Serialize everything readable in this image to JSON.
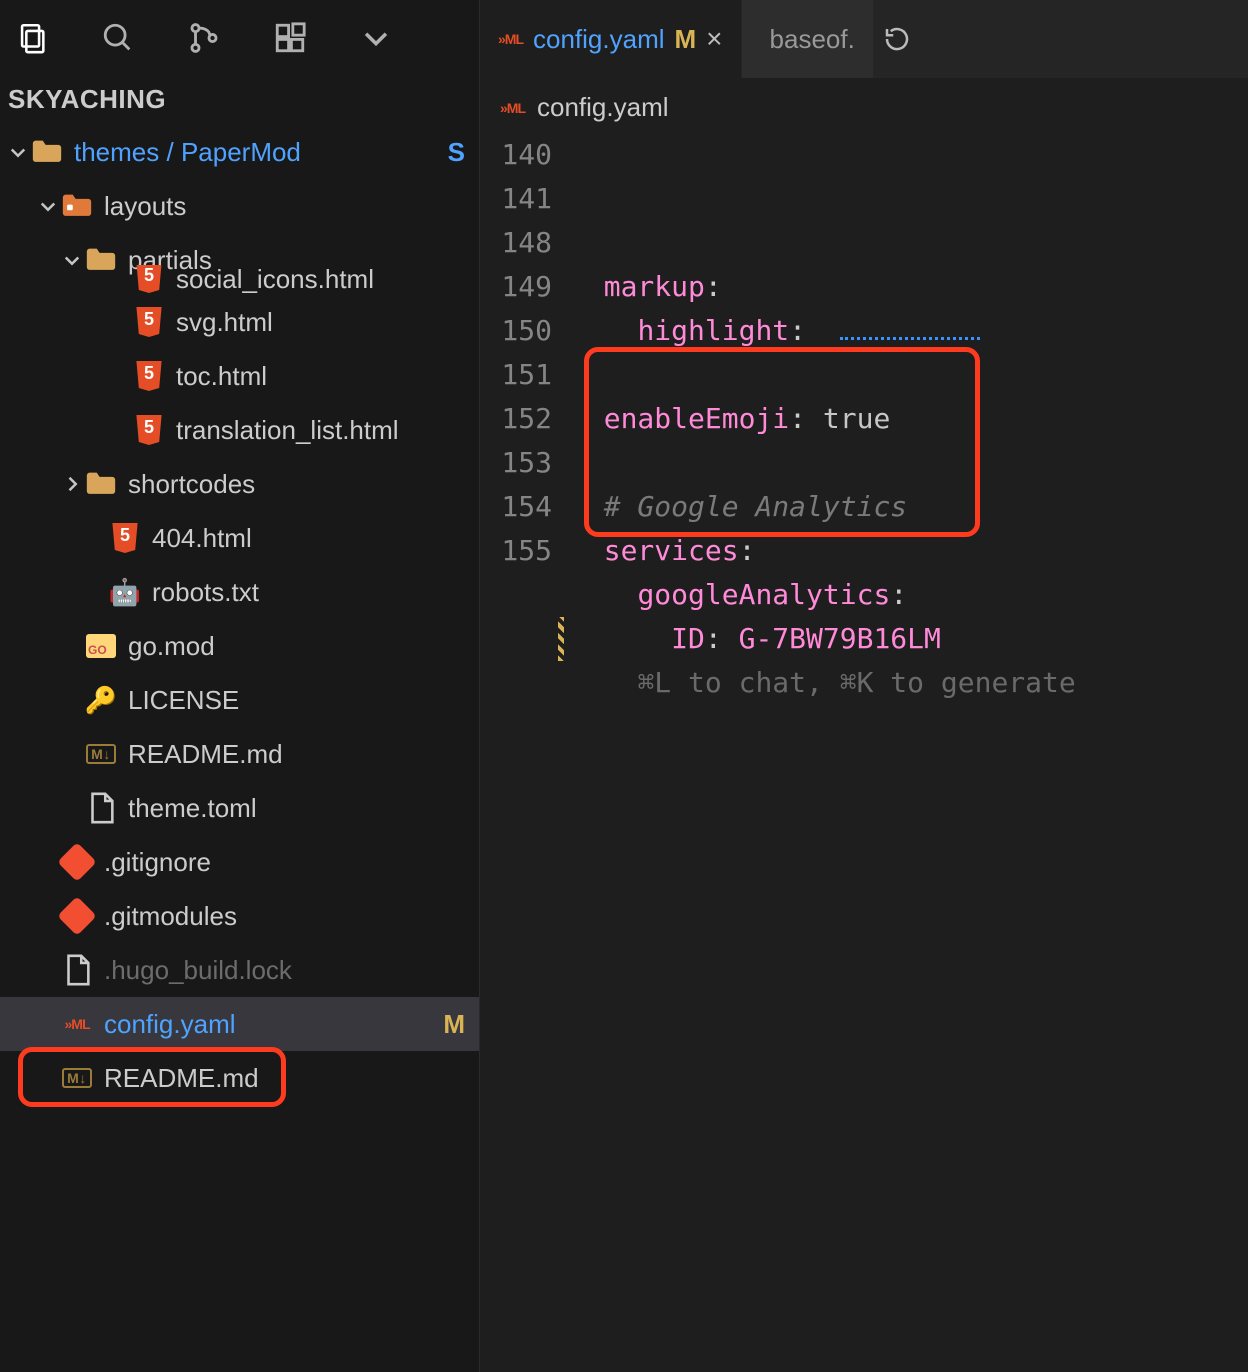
{
  "explorer": {
    "title": "SKYACHING",
    "root": {
      "label_a": "themes",
      "sep": " / ",
      "label_b": "PaperMod",
      "badge": "S"
    },
    "rows": [
      {
        "indent": 36,
        "chev": "v",
        "icon": "folder-orange",
        "label": "layouts"
      },
      {
        "indent": 60,
        "chev": "v",
        "icon": "folder",
        "label": "partials"
      },
      {
        "indent": 108,
        "chev": "",
        "icon": "html5",
        "label": "social_icons.html",
        "cut": true
      },
      {
        "indent": 108,
        "chev": "",
        "icon": "html5",
        "label": "svg.html"
      },
      {
        "indent": 108,
        "chev": "",
        "icon": "html5",
        "label": "toc.html"
      },
      {
        "indent": 108,
        "chev": "",
        "icon": "html5",
        "label": "translation_list.html"
      },
      {
        "indent": 60,
        "chev": ">",
        "icon": "folder",
        "label": "shortcodes"
      },
      {
        "indent": 84,
        "chev": "",
        "icon": "html5",
        "label": "404.html"
      },
      {
        "indent": 84,
        "chev": "",
        "icon": "robot",
        "label": "robots.txt"
      },
      {
        "indent": 60,
        "chev": "",
        "icon": "go",
        "label": "go.mod"
      },
      {
        "indent": 60,
        "chev": "",
        "icon": "key",
        "label": "LICENSE"
      },
      {
        "indent": 60,
        "chev": "",
        "icon": "md",
        "label": "README.md"
      },
      {
        "indent": 60,
        "chev": "",
        "icon": "file",
        "label": "theme.toml"
      },
      {
        "indent": 36,
        "chev": "",
        "icon": "git",
        "label": ".gitignore"
      },
      {
        "indent": 36,
        "chev": "",
        "icon": "git",
        "label": ".gitmodules"
      },
      {
        "indent": 36,
        "chev": "",
        "icon": "file",
        "label": ".hugo_build.lock",
        "dim": true
      },
      {
        "indent": 36,
        "chev": "",
        "icon": "yaml",
        "label": "config.yaml",
        "blue": true,
        "badge": "M",
        "selected": true
      },
      {
        "indent": 36,
        "chev": "",
        "icon": "md",
        "label": "README.md"
      }
    ]
  },
  "tabs": {
    "active": {
      "icon": "yaml",
      "label": "config.yaml",
      "mod": "M"
    },
    "inactive": {
      "icon": "html5",
      "label": "baseof."
    }
  },
  "breadcrumb": {
    "icon": "yaml",
    "label": "config.yaml"
  },
  "code": {
    "lines": [
      {
        "n": "140",
        "indent": 2,
        "parts": [
          [
            "key",
            "markup"
          ],
          [
            "c",
            ":"
          ]
        ]
      },
      {
        "n": "141",
        "indent": 4,
        "parts": [
          [
            "key",
            "highlight"
          ],
          [
            "c",
            ":"
          ]
        ],
        "squiggle": true
      },
      {
        "n": "148",
        "indent": 0,
        "parts": []
      },
      {
        "n": "149",
        "indent": 2,
        "parts": [
          [
            "key",
            "enableEmoji"
          ],
          [
            "c",
            ": "
          ],
          [
            "id",
            "true"
          ]
        ]
      },
      {
        "n": "150",
        "indent": 0,
        "parts": []
      },
      {
        "n": "151",
        "indent": 2,
        "parts": [
          [
            "comment",
            "# Google Analytics"
          ]
        ]
      },
      {
        "n": "152",
        "indent": 2,
        "parts": [
          [
            "key",
            "services"
          ],
          [
            "c",
            ":"
          ]
        ]
      },
      {
        "n": "153",
        "indent": 4,
        "parts": [
          [
            "key",
            "googleAnalytics"
          ],
          [
            "c",
            ":"
          ]
        ]
      },
      {
        "n": "154",
        "indent": 6,
        "parts": [
          [
            "key",
            "ID"
          ],
          [
            "c",
            ": "
          ],
          [
            "str",
            "G-7BW79B16LM"
          ]
        ],
        "mod": true
      },
      {
        "n": "155",
        "indent": 4,
        "hint": "⌘L to chat, ⌘K to generate"
      }
    ]
  }
}
